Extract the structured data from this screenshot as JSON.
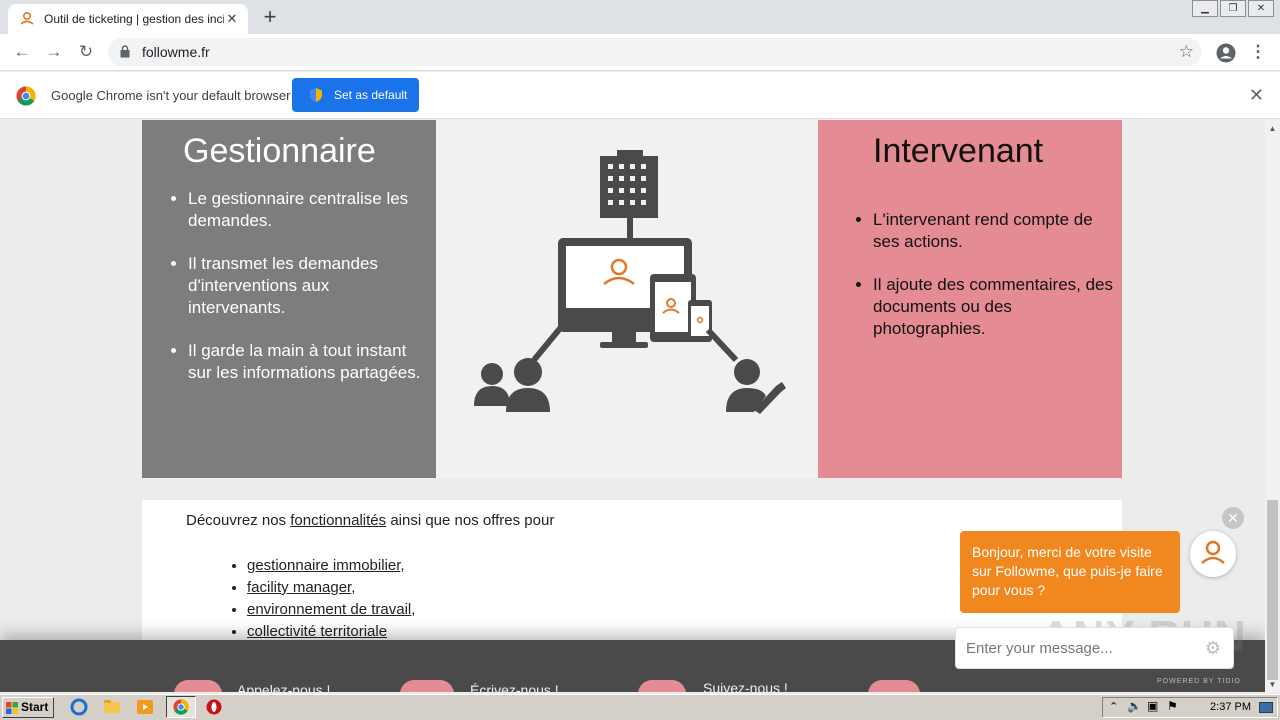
{
  "browser": {
    "tab_title": "Outil de ticketing | gestion des incide",
    "tab_close": "✕",
    "new_tab": "+",
    "url": "followme.fr",
    "infobar_text": "Google Chrome isn't your default browser",
    "set_default_label": "Set as default",
    "infobar_close": "✕"
  },
  "page": {
    "gestionnaire": {
      "title": "Gestionnaire",
      "items": [
        "Le gestionnaire centralise les demandes.",
        "Il transmet les demandes d'interventions aux intervenants.",
        "Il garde la main à tout instant sur les informations partagées."
      ]
    },
    "intervenant": {
      "title": "Intervenant",
      "items": [
        "L'intervenant rend compte de ses actions.",
        "Il ajoute des commentaires, des documents ou des photographies."
      ]
    },
    "discover": {
      "prefix": "Découvrez nos",
      "link": "fonctionnalités",
      "suffix": "ainsi que nos offres pour",
      "offers": [
        "gestionnaire immobilier",
        "facility manager",
        "environnement de travail",
        "collectivité territoriale"
      ],
      "separators": [
        ",",
        ",",
        ",",
        ""
      ]
    },
    "footer": [
      "Appelez-nous !",
      "Écrivez-nous !",
      "Suivez-nous !"
    ]
  },
  "chat": {
    "message": "Bonjour, merci de votre visite sur Followme, que puis-je faire pour vous ?",
    "input_placeholder": "Enter your message...",
    "powered": "POWERED BY TIDIO",
    "close": "✕"
  },
  "watermark": "ANY RUN",
  "taskbar": {
    "start": "Start",
    "clock": "2:37 PM"
  },
  "colors": {
    "gestionnaire_bg": "#7d7d7d",
    "intervenant_bg": "#e58b93",
    "chat_orange": "#f1871f",
    "chrome_blue": "#1a73e8"
  }
}
